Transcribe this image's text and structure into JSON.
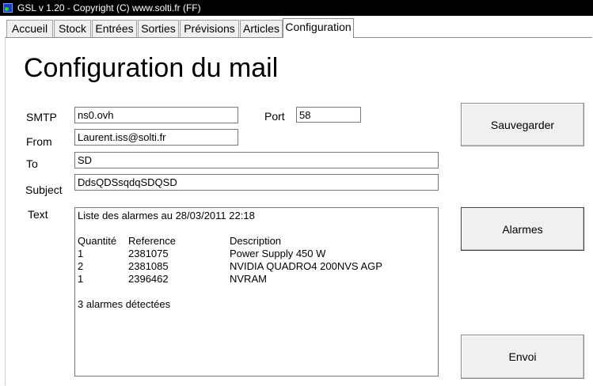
{
  "window": {
    "title": "GSL v 1.20 - Copyright (C) www.solti.fr  (FF)",
    "icon": "app-icon"
  },
  "tabs": [
    {
      "label": "Accueil"
    },
    {
      "label": "Stock"
    },
    {
      "label": "Entrées"
    },
    {
      "label": "Sorties"
    },
    {
      "label": "Prévisions"
    },
    {
      "label": "Articles"
    },
    {
      "label": "Configuration"
    }
  ],
  "active_tab": "Configuration",
  "page": {
    "title": "Configuration du mail"
  },
  "form": {
    "smtp_label": "SMTP",
    "smtp_value": "ns0.ovh",
    "port_label": "Port",
    "port_value": "58",
    "from_label": "From",
    "from_value": "Laurent.iss@solti.fr",
    "to_label": "To",
    "to_value": "SD",
    "subject_label": "Subject",
    "subject_value": "DdsQDSsqdqSDQSD",
    "text_label": "Text"
  },
  "message": {
    "intro": "Liste des alarmes au 28/03/2011 22:18",
    "headers": [
      "Quantité",
      "Reference",
      "Description"
    ],
    "rows": [
      {
        "qty": "1",
        "ref": "2381075",
        "desc": "Power Supply 450 W"
      },
      {
        "qty": "2",
        "ref": "2381085",
        "desc": "NVIDIA QUADRO4 200NVS AGP"
      },
      {
        "qty": "1",
        "ref": "2396462",
        "desc": "NVRAM"
      }
    ],
    "summary": "3 alarmes détectées"
  },
  "buttons": {
    "save_label": "Sauvegarder",
    "alarms_label": "Alarmes",
    "send_label": "Envoi"
  },
  "colors": {
    "titlebar_bg": "#000000",
    "titlebar_text": "#ffffff",
    "button_bg": "#f0f0f0",
    "tab_bg": "#f0f0f0"
  }
}
